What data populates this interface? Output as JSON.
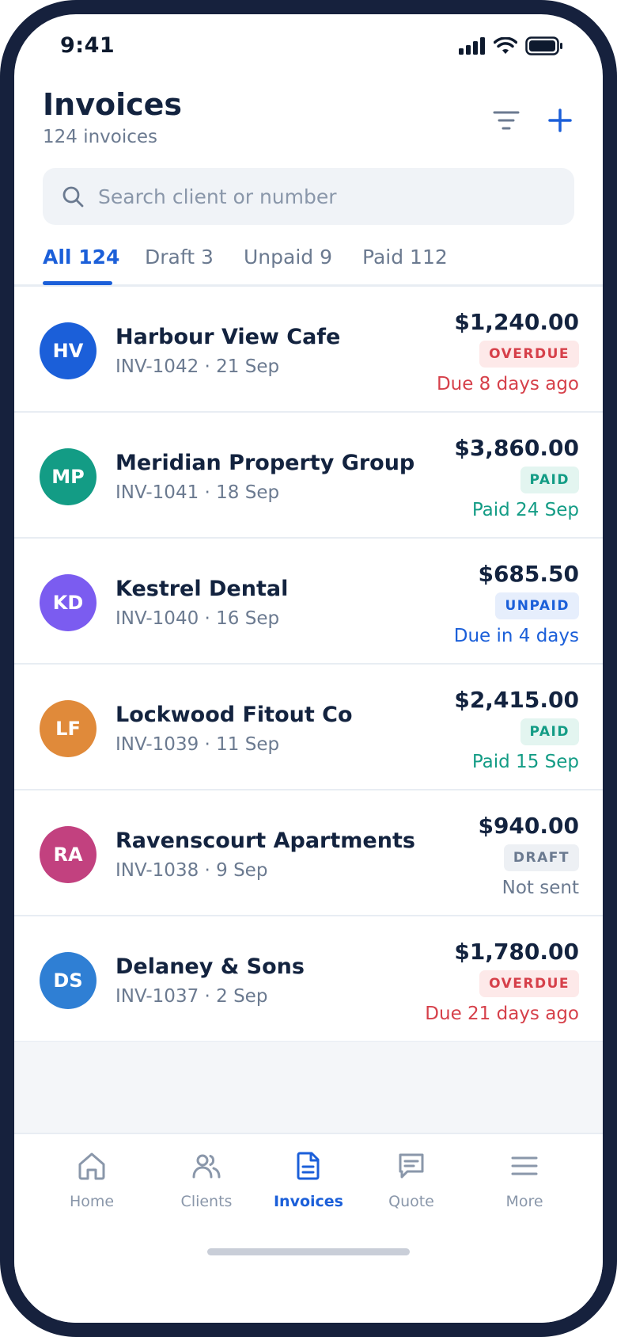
{
  "status_bar": {
    "time": "9:41"
  },
  "header": {
    "title": "Invoices",
    "subtitle": "124 invoices"
  },
  "search": {
    "placeholder": "Search client or number",
    "value": ""
  },
  "tabs": [
    {
      "label": "All 124",
      "active": true
    },
    {
      "label": "Draft 3",
      "active": false
    },
    {
      "label": "Unpaid 9",
      "active": false
    },
    {
      "label": "Paid 112",
      "active": false
    }
  ],
  "invoices": [
    {
      "initials": "HV",
      "avatar_color": "#1b5fd9",
      "client": "Harbour View Cafe",
      "meta": "INV-1042 · 21 Sep",
      "amount": "$1,240.00",
      "status": "OVERDUE",
      "status_kind": "overdue",
      "note": "Due 8 days ago"
    },
    {
      "initials": "MP",
      "avatar_color": "#139c85",
      "client": "Meridian Property Group",
      "meta": "INV-1041 · 18 Sep",
      "amount": "$3,860.00",
      "status": "PAID",
      "status_kind": "paid",
      "note": "Paid 24 Sep"
    },
    {
      "initials": "KD",
      "avatar_color": "#7b5cf0",
      "client": "Kestrel Dental",
      "meta": "INV-1040 · 16 Sep",
      "amount": "$685.50",
      "status": "UNPAID",
      "status_kind": "unpaid",
      "note": "Due in 4 days"
    },
    {
      "initials": "LF",
      "avatar_color": "#e08a3a",
      "client": "Lockwood Fitout Co",
      "meta": "INV-1039 · 11 Sep",
      "amount": "$2,415.00",
      "status": "PAID",
      "status_kind": "paid",
      "note": "Paid 15 Sep"
    },
    {
      "initials": "RA",
      "avatar_color": "#c2417f",
      "client": "Ravenscourt Apartments",
      "meta": "INV-1038 · 9 Sep",
      "amount": "$940.00",
      "status": "DRAFT",
      "status_kind": "draft",
      "note": "Not sent"
    },
    {
      "initials": "DS",
      "avatar_color": "#2f7fd4",
      "client": "Delaney & Sons",
      "meta": "INV-1037 · 2 Sep",
      "amount": "$1,780.00",
      "status": "OVERDUE",
      "status_kind": "overdue",
      "note": "Due 21 days ago"
    }
  ],
  "bottom_nav": [
    {
      "label": "Home",
      "icon": "home-icon",
      "active": false
    },
    {
      "label": "Clients",
      "icon": "users-icon",
      "active": false
    },
    {
      "label": "Invoices",
      "icon": "document-icon",
      "active": true
    },
    {
      "label": "Quote",
      "icon": "chat-icon",
      "active": false
    },
    {
      "label": "More",
      "icon": "menu-icon",
      "active": false
    }
  ],
  "colors": {
    "accent": "#1b5fd9",
    "frame": "#16213d",
    "overdue": "#d6404a",
    "paid": "#139c85",
    "draft": "#6b7a90"
  }
}
